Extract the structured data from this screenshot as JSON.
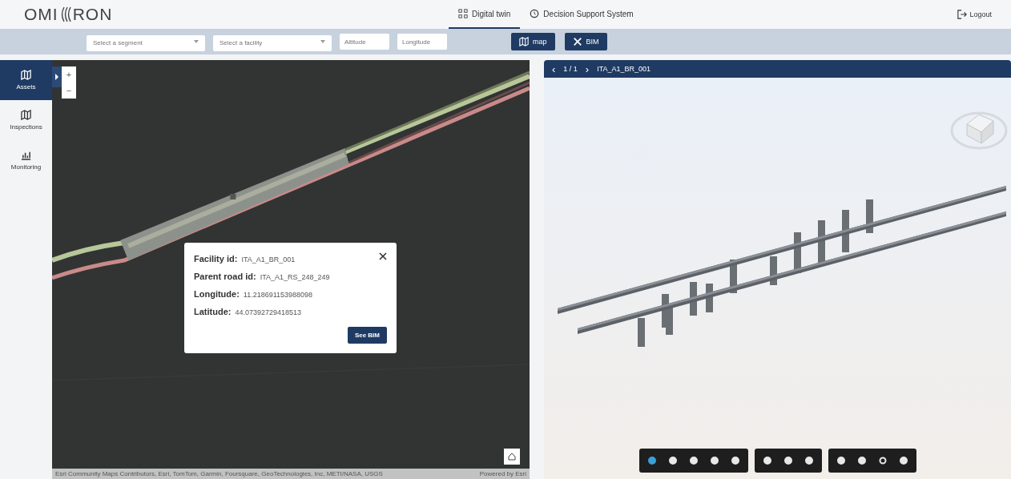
{
  "header": {
    "logo_left": "OMI",
    "logo_right": "RON",
    "tabs": [
      {
        "label": "Digital twin",
        "selected": true
      },
      {
        "label": "Decision Support System",
        "selected": false
      }
    ],
    "logout": "Logout"
  },
  "filters": {
    "segment": {
      "placeholder": "Select a segment"
    },
    "facility": {
      "placeholder": "Select a facility"
    },
    "altitude": {
      "placeholder": "Altitude"
    },
    "longitude": {
      "placeholder": "Longitude"
    }
  },
  "view_buttons": [
    {
      "label": "map",
      "selected": false
    },
    {
      "label": "BIM",
      "selected": false
    }
  ],
  "sidebar": {
    "items": [
      {
        "label": "Assets",
        "selected": true
      },
      {
        "label": "Inspections",
        "selected": false
      },
      {
        "label": "Monitoring",
        "selected": false
      }
    ]
  },
  "map": {
    "zoom_in": "+",
    "zoom_out": "−",
    "attribution": "Esri Community Maps Contributors, Esri, TomTom, Garmin, Foursquare, GeoTechnologies, Inc, METI/NASA, USGS",
    "powered_by": "Powered by Esri"
  },
  "popup": {
    "fields": [
      {
        "label": "Facility id:",
        "value": "ITA_A1_BR_001"
      },
      {
        "label": "Parent road id:",
        "value": "ITA_A1_RS_248_249"
      },
      {
        "label": "Longitude:",
        "value": "11.218691153988098"
      },
      {
        "label": "Latitude:",
        "value": "44.07392729418513"
      }
    ],
    "button": "See BIM"
  },
  "viewer": {
    "prev": "‹",
    "page": "1 / 1",
    "next": "›",
    "title": "ITA_A1_BR_001",
    "tool_groups": [
      [
        {
          "selected": true
        },
        {
          "selected": false
        },
        {
          "selected": false
        },
        {
          "selected": false
        },
        {
          "selected": false
        }
      ],
      [
        {
          "selected": false
        },
        {
          "selected": false
        },
        {
          "selected": false
        }
      ],
      [
        {
          "selected": false
        },
        {
          "selected": false
        },
        {
          "selected": false
        },
        {
          "selected": false
        }
      ]
    ]
  }
}
